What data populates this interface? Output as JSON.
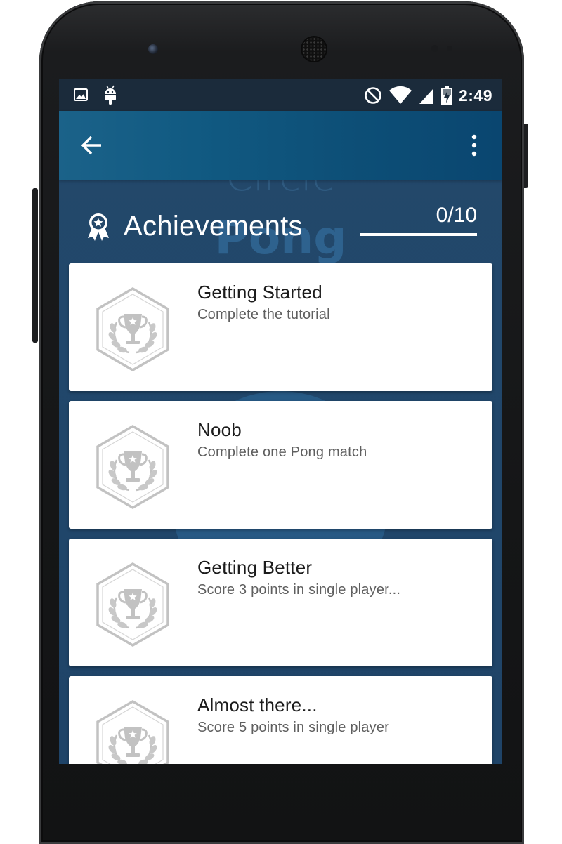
{
  "status_bar": {
    "time": "2:49",
    "left_icons": [
      "image-icon",
      "android-icon"
    ],
    "right_icons": [
      "do-not-disturb-icon",
      "wifi-icon",
      "signal-icon",
      "battery-charging-icon"
    ]
  },
  "toolbar": {
    "back_icon": "arrow-back-icon",
    "menu_icon": "more-vert-icon"
  },
  "background": {
    "watermark_line1": "Circle",
    "watermark_line2": "Pong"
  },
  "header": {
    "icon": "award-ribbon-icon",
    "title": "Achievements",
    "progress_text": "0/10",
    "progress_fraction": 0
  },
  "achievements": [
    {
      "title": "Getting Started",
      "description": "Complete the tutorial",
      "icon": "trophy-badge-icon",
      "locked": true
    },
    {
      "title": "Noob",
      "description": "Complete one Pong match",
      "icon": "trophy-badge-icon",
      "locked": true
    },
    {
      "title": "Getting Better",
      "description": "Score 3 points in single player...",
      "icon": "trophy-badge-icon",
      "locked": true
    },
    {
      "title": "Almost there...",
      "description": "Score 5 points in single player",
      "icon": "trophy-badge-icon",
      "locked": true
    }
  ],
  "colors": {
    "toolbar": "#0d4f77",
    "screen_background": "#21476b",
    "status_bar": "#1b2b3b",
    "badge_locked": "#c2c2c2",
    "card": "#ffffff"
  }
}
